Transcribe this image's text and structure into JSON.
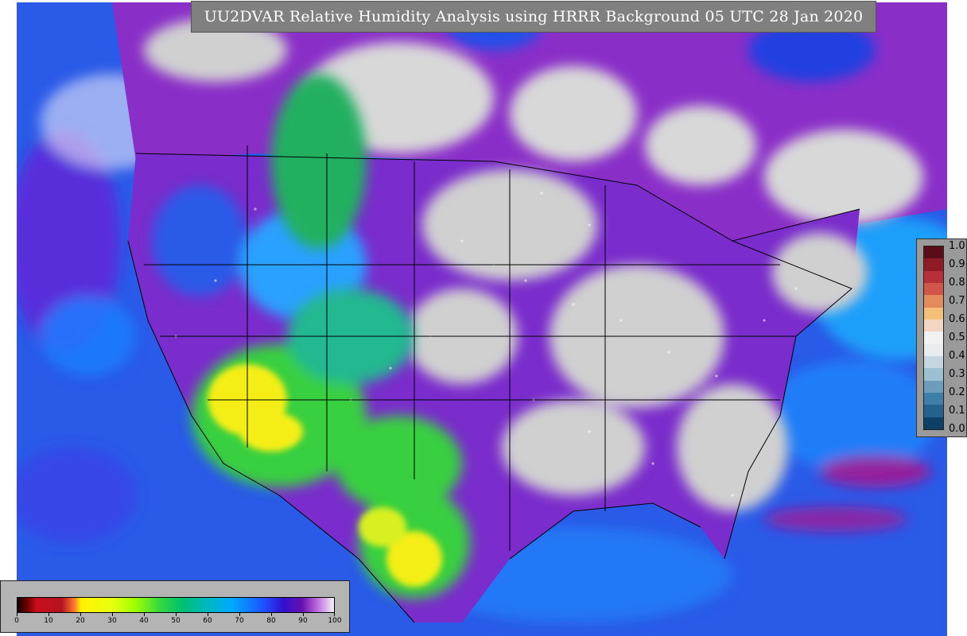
{
  "title": "UU2DVAR Relative Humidity Analysis using HRRR Background 05 UTC 28 Jan 2020",
  "obs_legend": {
    "ticks": [
      "1.0",
      "0.9",
      "0.8",
      "0.7",
      "0.6",
      "0.5",
      "0.4",
      "0.3",
      "0.2",
      "0.1",
      "0.0"
    ],
    "colors": [
      "#5a0d19",
      "#8e1b26",
      "#b6303a",
      "#d2554b",
      "#e38b5c",
      "#f4bf79",
      "#f3d6c2",
      "#f2f2f2",
      "#e9ecef",
      "#c5d6e0",
      "#9cbfd1",
      "#6d9dba",
      "#3f7ea6",
      "#22628d",
      "#0d3f67"
    ]
  },
  "rh_legend": {
    "ticks": [
      "0",
      "10",
      "20",
      "30",
      "40",
      "50",
      "60",
      "70",
      "80",
      "90",
      "100"
    ]
  },
  "map": {
    "background_color": "#2a62e8",
    "land_humid_color": "#a43ad0",
    "land_dry_color": "#3cd84a",
    "desert_color": "#f6ef1c",
    "cloud_color": "#d4d4d4"
  }
}
